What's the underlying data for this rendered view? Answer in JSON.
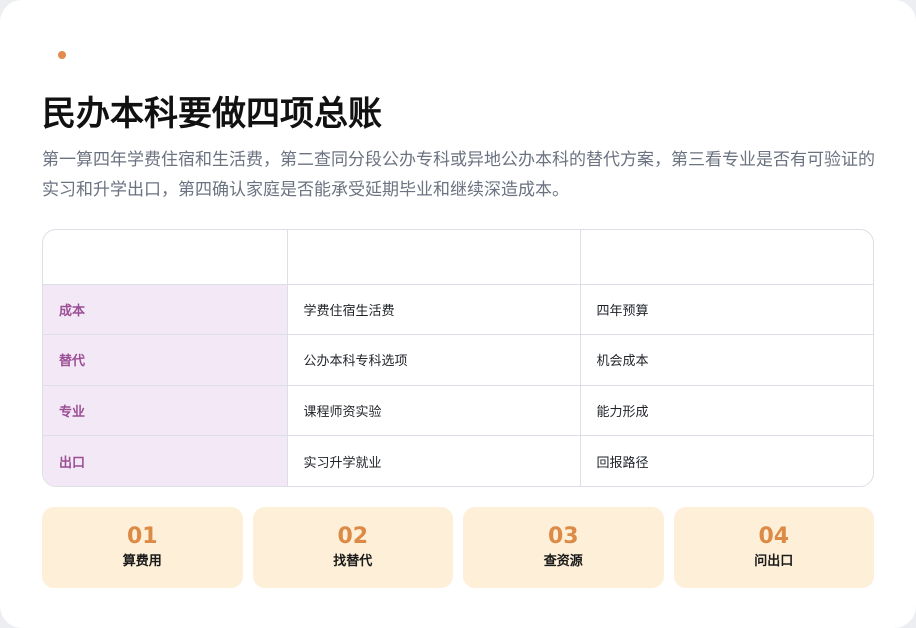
{
  "header": {
    "title": "民办本科要做四项总账",
    "description": "第一算四年学费住宿和生活费，第二查同分段公办专科或异地公办本科的替代方案，第三看专业是否有可验证的实习和升学出口，第四确认家庭是否能承受延期毕业和继续深造成本。",
    "accent_color": "#e38a4e"
  },
  "table": {
    "headers": [
      "",
      "",
      ""
    ],
    "rows": [
      {
        "label": "成本",
        "col1": "学费住宿生活费",
        "col2": "四年预算"
      },
      {
        "label": "替代",
        "col1": "公办本科专科选项",
        "col2": "机会成本"
      },
      {
        "label": "专业",
        "col1": "课程师资实验",
        "col2": "能力形成"
      },
      {
        "label": "出口",
        "col1": "实习升学就业",
        "col2": "回报路径"
      }
    ]
  },
  "steps": [
    {
      "num": "01",
      "label": "算费用"
    },
    {
      "num": "02",
      "label": "找替代"
    },
    {
      "num": "03",
      "label": "查资源"
    },
    {
      "num": "04",
      "label": "问出口"
    }
  ]
}
